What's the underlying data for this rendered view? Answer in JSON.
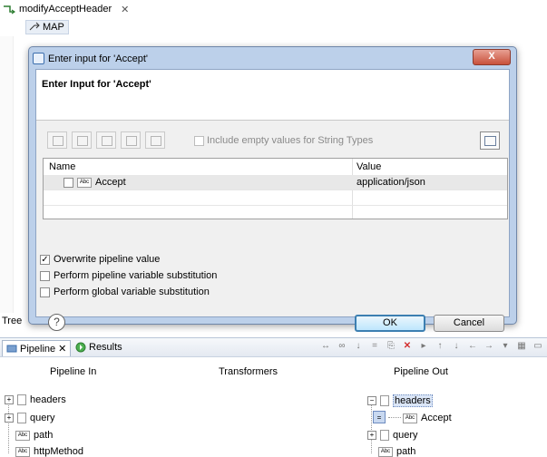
{
  "editor": {
    "tab_title": "modifyAcceptHeader",
    "map_label": "MAP",
    "tree_label": "Tree"
  },
  "dialog": {
    "window_title": "Enter input for 'Accept'",
    "heading": "Enter Input for 'Accept'",
    "include_empty_label": "Include empty values for String Types",
    "table": {
      "columns": [
        "Name",
        "Value"
      ],
      "rows": [
        {
          "name": "Accept",
          "value": "application/json"
        }
      ]
    },
    "options": [
      {
        "label": "Overwrite pipeline value",
        "checked": true
      },
      {
        "label": "Perform pipeline variable substitution",
        "checked": false
      },
      {
        "label": "Perform global variable substitution",
        "checked": false
      }
    ],
    "ok_label": "OK",
    "cancel_label": "Cancel",
    "help_glyph": "?",
    "close_glyph": "X"
  },
  "pipeline": {
    "tabs": [
      "Pipeline",
      "Results"
    ],
    "columns": [
      "Pipeline In",
      "Transformers",
      "Pipeline Out"
    ],
    "pipeline_in": [
      "headers",
      "query",
      "path",
      "httpMethod"
    ],
    "pipeline_out": [
      "headers",
      "Accept",
      "query",
      "path"
    ]
  },
  "colors": {
    "dialog_frame": "#bcd0ea",
    "ok_border": "#3c7fb1",
    "close_button": "#c8513b",
    "selection": "#dbe6f7"
  }
}
